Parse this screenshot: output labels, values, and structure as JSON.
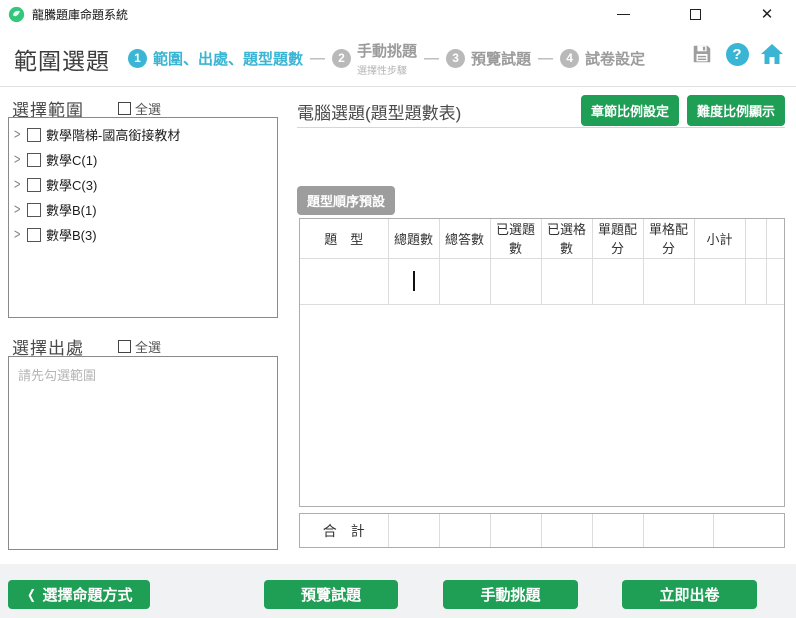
{
  "window": {
    "title": "龍騰題庫命題系統"
  },
  "header": {
    "page_title": "範圍選題",
    "steps": [
      {
        "num": "1",
        "label": "範圍、出處、題型題數",
        "sublabel": ""
      },
      {
        "num": "2",
        "label": "手動挑題",
        "sublabel": "選擇性步驟"
      },
      {
        "num": "3",
        "label": "預覽試題",
        "sublabel": ""
      },
      {
        "num": "4",
        "label": "試卷設定",
        "sublabel": ""
      }
    ],
    "dash": "—",
    "help_glyph": "?"
  },
  "left": {
    "range_section": {
      "title": "選擇範圍",
      "select_all_label": "全選",
      "items": [
        "數學階梯-國高銜接教材",
        "數學C(1)",
        "數學C(3)",
        "數學B(1)",
        "數學B(3)"
      ]
    },
    "source_section": {
      "title": "選擇出處",
      "select_all_label": "全選",
      "placeholder": "請先勾選範圍"
    }
  },
  "right": {
    "title": "電腦選題(題型題數表)",
    "chapter_ratio_button": "章節比例設定",
    "difficulty_ratio_button": "難度比例顯示",
    "order_badge": "題型順序預設",
    "table": {
      "headers": [
        "題　型",
        "總題數",
        "總答數",
        "已選題數",
        "已選格數",
        "單題配分",
        "單格配分",
        "小計",
        "",
        ""
      ],
      "total_label": "合　計"
    }
  },
  "footer": {
    "back_button": "選擇命題方式",
    "back_chevron": "❮",
    "preview_button": "預覽試題",
    "manual_button": "手動挑題",
    "generate_button": "立即出卷"
  },
  "colors": {
    "accent_green": "#1f9e55",
    "accent_cyan": "#3ab5d4",
    "inactive_gray": "#b9b9b9"
  }
}
